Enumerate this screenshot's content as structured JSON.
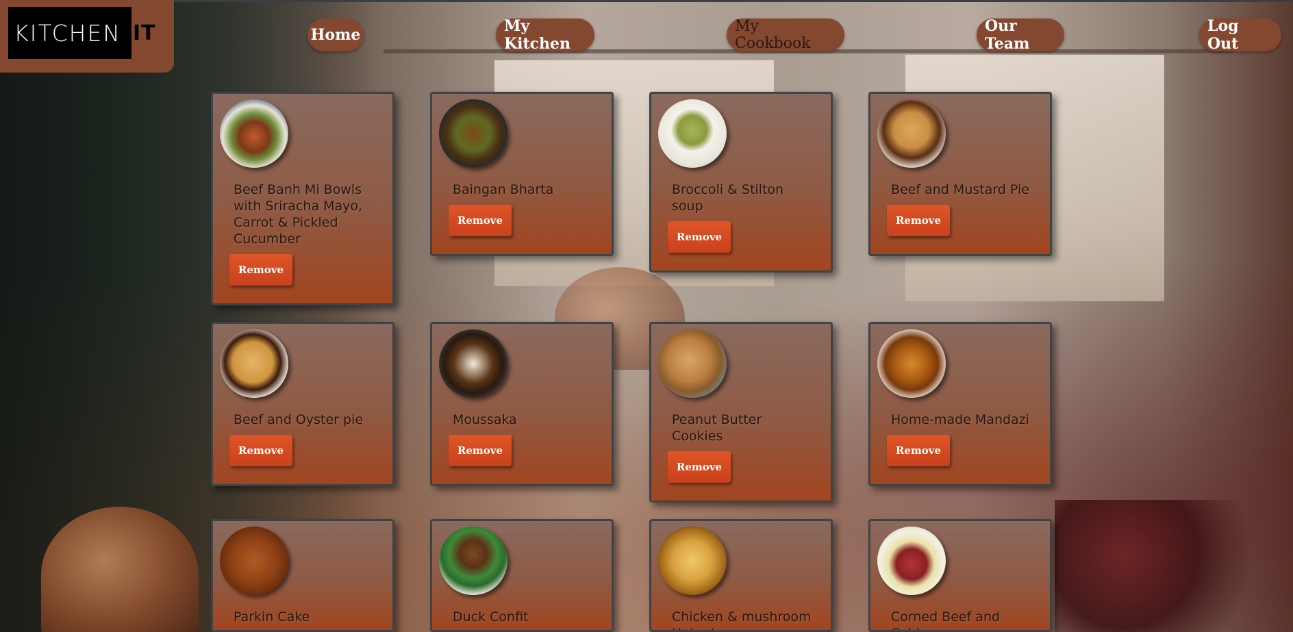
{
  "header": {
    "logo_text": "KITCHEN",
    "logo_accent": "IT",
    "nav": [
      {
        "label": "Home"
      },
      {
        "label": "My Kitchen"
      },
      {
        "label": "My Cookbook"
      },
      {
        "label": "Our Team"
      },
      {
        "label": "Log Out"
      }
    ],
    "active_nav": "My Cookbook"
  },
  "cookbook": {
    "remove_label": "Remove",
    "recipes": [
      {
        "title": "Beef Banh Mi Bowls with Sriracha Mayo, Carrot & Pickled Cucumber",
        "image": "beef-banh-mi-bowl-photo"
      },
      {
        "title": "Baingan Bharta",
        "image": "baingan-bharta-photo"
      },
      {
        "title": "Broccoli & Stilton soup",
        "image": "broccoli-stilton-soup-photo"
      },
      {
        "title": "Beef and Mustard Pie",
        "image": "beef-mustard-pie-photo"
      },
      {
        "title": "Beef and Oyster pie",
        "image": "beef-oyster-pie-photo"
      },
      {
        "title": "Moussaka",
        "image": "moussaka-photo"
      },
      {
        "title": "Peanut Butter Cookies",
        "image": "peanut-butter-cookies-photo"
      },
      {
        "title": "Home-made Mandazi",
        "image": "mandazi-photo"
      },
      {
        "title": "Parkin Cake",
        "image": "parkin-cake-photo"
      },
      {
        "title": "Duck Confit",
        "image": "duck-confit-photo"
      },
      {
        "title": "Chicken & mushroom Hotpot",
        "image": "chicken-mushroom-hotpot-photo"
      },
      {
        "title": "Corned Beef and Cabbage",
        "image": "corned-beef-cabbage-photo"
      }
    ]
  },
  "colors": {
    "header_plate": "#84472f",
    "card_border": "#3e4347",
    "remove_button": "#d44b22"
  }
}
